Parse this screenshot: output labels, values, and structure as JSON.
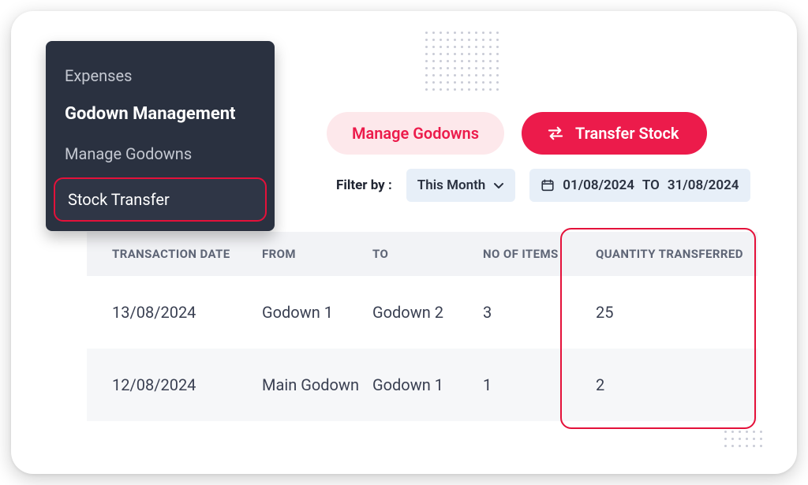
{
  "sidebar": {
    "expenses": "Expenses",
    "heading": "Godown Management",
    "manage": "Manage Godowns",
    "active": "Stock Transfer"
  },
  "actions": {
    "manage": "Manage Godowns",
    "transfer": "Transfer Stock"
  },
  "filter": {
    "label": "Filter by :",
    "period": "This Month",
    "from": "01/08/2024",
    "sep": "TO",
    "to": "31/08/2024"
  },
  "table": {
    "headers": {
      "date": "TRANSACTION DATE",
      "from": "FROM",
      "to": "TO",
      "items": "NO OF ITEMS",
      "qty": "QUANTITY TRANSFERRED"
    },
    "rows": [
      {
        "date": "13/08/2024",
        "from": "Godown 1",
        "to": "Godown 2",
        "items": "3",
        "qty": "25"
      },
      {
        "date": "12/08/2024",
        "from": "Main Godown",
        "to": "Godown 1",
        "items": "1",
        "qty": "2"
      }
    ]
  },
  "colors": {
    "accent": "#ec1b4b",
    "sidebar": "#2a3140",
    "chip": "#e7eff8"
  }
}
